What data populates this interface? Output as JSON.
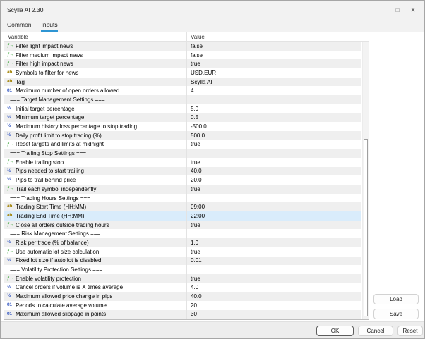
{
  "window": {
    "title": "Scylla AI 2.30"
  },
  "tabs": {
    "common": "Common",
    "inputs": "Inputs",
    "active_tab": "Inputs"
  },
  "icons": {
    "maximize": "□",
    "close": "✕",
    "bool_input": "ƒ→",
    "string_input": "ab",
    "int_input": "01",
    "double_input": "½"
  },
  "table": {
    "columns": {
      "variable": "Variable",
      "value": "Value"
    },
    "rows": [
      {
        "icon": "bool",
        "variable": "Filter light impact news",
        "value": "false"
      },
      {
        "icon": "bool",
        "variable": "Filter medium impact news",
        "value": "false"
      },
      {
        "icon": "bool",
        "variable": "Filter high impact news",
        "value": "true"
      },
      {
        "icon": "string",
        "variable": "Symbols to filter for news",
        "value": "USD,EUR"
      },
      {
        "icon": "string",
        "variable": "Tag",
        "value": "Scylla AI"
      },
      {
        "icon": "int",
        "variable": "Maximum number of open orders allowed",
        "value": "4"
      },
      {
        "icon": "section",
        "variable": "=== Target Management Settings ===",
        "value": ""
      },
      {
        "icon": "double",
        "variable": "Initial target percentage",
        "value": "5.0"
      },
      {
        "icon": "double",
        "variable": "Minimum target percentage",
        "value": "0.5"
      },
      {
        "icon": "double",
        "variable": "Maximum history loss percentage to stop trading",
        "value": "-500.0"
      },
      {
        "icon": "double",
        "variable": "Daily profit limit to stop trading (%)",
        "value": "500.0"
      },
      {
        "icon": "bool",
        "variable": "Reset targets and limits at midnight",
        "value": "true"
      },
      {
        "icon": "section",
        "variable": "=== Trailing Stop Settings ===",
        "value": ""
      },
      {
        "icon": "bool",
        "variable": "Enable trailing stop",
        "value": "true"
      },
      {
        "icon": "double",
        "variable": "Pips needed to start trailing",
        "value": "40.0"
      },
      {
        "icon": "double",
        "variable": "Pips to trail behind price",
        "value": "20.0"
      },
      {
        "icon": "bool",
        "variable": "Trail each symbol independently",
        "value": "true"
      },
      {
        "icon": "section",
        "variable": "=== Trading Hours Settings ===",
        "value": ""
      },
      {
        "icon": "string",
        "variable": "Trading Start Time (HH:MM)",
        "value": "09:00"
      },
      {
        "icon": "string",
        "variable": "Trading End Time (HH:MM)",
        "value": "22:00",
        "selected": true
      },
      {
        "icon": "bool",
        "variable": "Close all orders outside trading hours",
        "value": "true"
      },
      {
        "icon": "section",
        "variable": "=== Risk Management Settings ===",
        "value": ""
      },
      {
        "icon": "double",
        "variable": "Risk per trade (% of balance)",
        "value": "1.0"
      },
      {
        "icon": "bool",
        "variable": "Use automatic lot size calculation",
        "value": "true"
      },
      {
        "icon": "double",
        "variable": "Fixed lot size if auto lot is disabled",
        "value": "0.01"
      },
      {
        "icon": "section",
        "variable": "=== Volatility Protection Settings ===",
        "value": ""
      },
      {
        "icon": "bool",
        "variable": "Enable volatility protection",
        "value": "true"
      },
      {
        "icon": "double",
        "variable": "Cancel orders if volume is X times average",
        "value": "4.0"
      },
      {
        "icon": "double",
        "variable": "Maximum allowed price change in pips",
        "value": "40.0"
      },
      {
        "icon": "int",
        "variable": "Periods to calculate average volume",
        "value": "20"
      },
      {
        "icon": "int",
        "variable": "Maximum allowed slippage in points",
        "value": "30"
      }
    ]
  },
  "side_buttons": {
    "load": "Load",
    "save": "Save"
  },
  "bottom_buttons": {
    "ok": "OK",
    "cancel": "Cancel",
    "reset": "Reset"
  },
  "colors": {
    "accent_tab_underline": "#2e95d3",
    "selected_row_bg": "#d9ecfb",
    "row_alt_bg": "#efefef",
    "bool_icon": "#31a12f",
    "string_icon": "#a08000",
    "number_icon": "#2f53c0",
    "chrome_bg": "#f2f2f2"
  }
}
